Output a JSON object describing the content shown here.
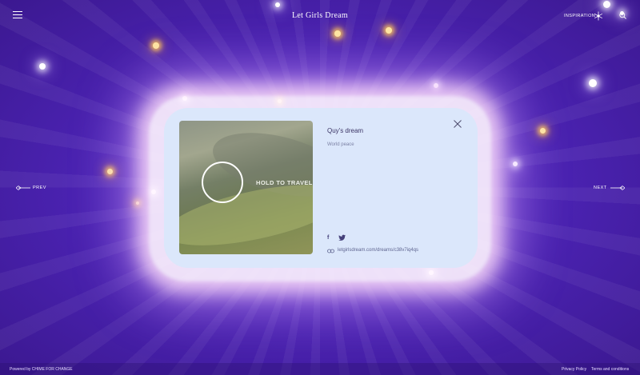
{
  "header": {
    "title": "Let Girls Dream",
    "menu_icon": "menu-icon",
    "inspiration_label": "INSPIRATION",
    "inspiration_icon": "sparkle-icon",
    "search_icon": "search-icon"
  },
  "navigation": {
    "prev_label": "PREV",
    "next_label": "NEXT"
  },
  "dream_card": {
    "video_overlay": "HOLD TO TRAVEL",
    "title": "Quy's dream",
    "text": "World peace",
    "share_icons": [
      "facebook-icon",
      "twitter-icon"
    ],
    "link_icon": "link-icon",
    "link_text": "letgirlsdream.com/dreams/c38v7iq4qs",
    "close_icon": "close-icon"
  },
  "footer": {
    "powered_by": "Powered by CHIME FOR CHANGE",
    "privacy": "Privacy Policy",
    "terms": "Terms and conditions"
  },
  "colors": {
    "background": "#5a2fc4",
    "card": "#dbe7fb",
    "card_title": "#3b3465",
    "star_warm": "#ffe6a0"
  }
}
